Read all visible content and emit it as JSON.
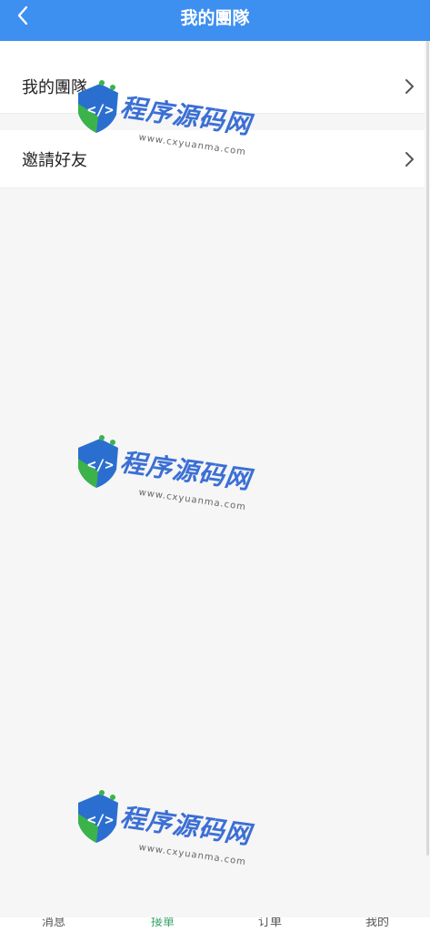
{
  "header": {
    "title": "我的團隊",
    "back_icon": "chevron-left-icon"
  },
  "menu": {
    "items": [
      {
        "label": "我的團隊",
        "icon": "chevron-right-icon"
      },
      {
        "label": "邀請好友",
        "icon": "chevron-right-icon"
      }
    ]
  },
  "tabbar": {
    "tabs": [
      {
        "label": "消息"
      },
      {
        "label": "接單"
      },
      {
        "label": "订单"
      },
      {
        "label": "我的"
      }
    ],
    "active_color": "#3aa56d"
  },
  "watermark": {
    "brand": "程序源码网",
    "brand_part1": "程序",
    "brand_part2": "源码网",
    "url": "www.cxyuanma.com"
  },
  "colors": {
    "header_bg": "#3d8ff0",
    "page_bg": "#f6f6f6"
  }
}
